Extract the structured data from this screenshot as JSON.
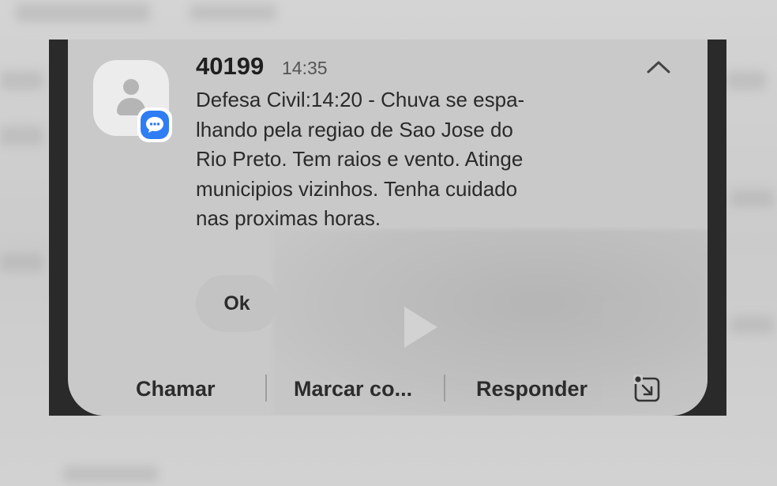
{
  "notification": {
    "sender": "40199",
    "time": "14:35",
    "message_lines": [
      "Defesa Civil:14:20 - Chuva se espa-",
      "lhando pela regiao de Sao Jose do",
      "Rio Preto. Tem raios e vento. Atinge",
      "municipios vizinhos. Tenha cuidado",
      "nas proximas horas."
    ],
    "ok_label": "Ok",
    "actions": {
      "call": "Chamar",
      "mark": "Marcar co...",
      "reply": "Responder"
    },
    "icons": {
      "avatar": "contact-avatar-icon",
      "app_badge": "messages-app-icon",
      "collapse": "chevron-up-icon",
      "popup": "open-in-popup-icon"
    },
    "colors": {
      "badge_blue": "#2f7df4",
      "card_bg": "#c9c9c9"
    }
  }
}
